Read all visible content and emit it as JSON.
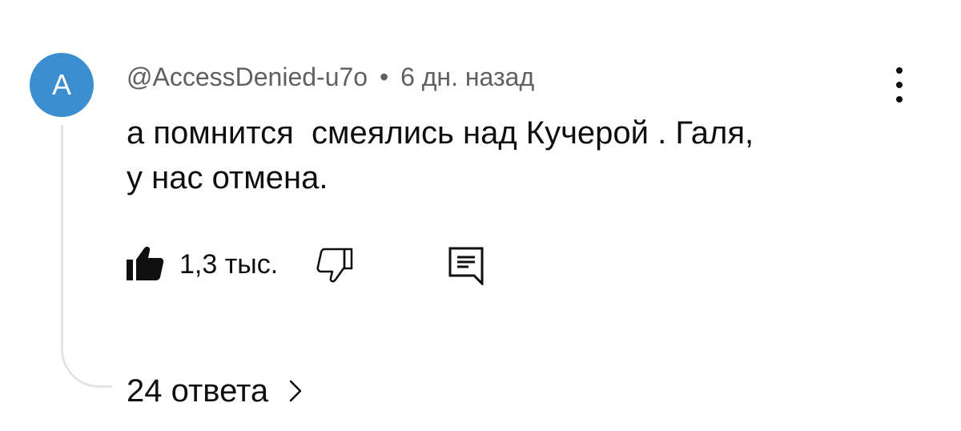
{
  "comment": {
    "avatar_letter": "A",
    "author": "@AccessDenied-u7o",
    "separator": "•",
    "time": "6 дн. назад",
    "text": "а помнится  смеялись над Кучерой . Галя,\nу нас отмена."
  },
  "actions": {
    "like_count": "1,3 тыс.",
    "like_icon": "thumb-up-filled-icon",
    "dislike_icon": "thumb-down-outline-icon",
    "reply_icon": "comment-reply-icon"
  },
  "replies": {
    "label": "24 ответа",
    "icon": "chevron-right-icon"
  },
  "menu": {
    "icon": "more-vertical-icon"
  },
  "colors": {
    "avatar_bg": "#3b8ed0",
    "meta_text": "#606060",
    "primary_text": "#0f0f0f",
    "thread_line": "#e3e3e3"
  }
}
